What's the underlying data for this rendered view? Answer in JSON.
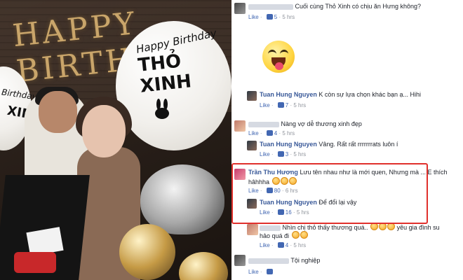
{
  "photo": {
    "banner_text": "HAPPY BIRTHDAY",
    "balloon_main_line1": "Happy Birthday",
    "balloon_main_line2": "THỎ XINH",
    "balloon_left_line1": "Birthday",
    "balloon_left_line2": "XINH"
  },
  "comments": [
    {
      "id": "c1",
      "text": "Cuối cùng Thỏ Xinh có chịu ăn Hưng không?",
      "like_label": "Like",
      "likes": "5",
      "time": "5 hrs"
    },
    {
      "id": "c2",
      "author": "Tuan Hung Nguyen",
      "text": "K còn sự lựa chọn khác bạn ạ... Hihi",
      "like_label": "Like",
      "likes": "7",
      "time": "5 hrs"
    },
    {
      "id": "c3",
      "text": "Nàng vợ dễ thương xinh đẹp",
      "like_label": "Like",
      "likes": "4",
      "time": "5 hrs"
    },
    {
      "id": "c4",
      "author": "Tuan Hung Nguyen",
      "text": "Vâng. Rất rất rrrrrrrats luôn í",
      "like_label": "Like",
      "likes": "3",
      "time": "5 hrs"
    },
    {
      "id": "c5",
      "author": "Trần Thu Hương",
      "text": "Lưu tên nhau như là mới quen, Nhưng mà ... E thích",
      "text2": "hâhhha",
      "like_label": "Like",
      "likes": "80",
      "time": "6 hrs"
    },
    {
      "id": "c6",
      "author": "Tuan Hung Nguyen",
      "text": "Để đổi lại vậy",
      "like_label": "Like",
      "likes": "16",
      "time": "5 hrs"
    },
    {
      "id": "c7",
      "text": "Nhìn chị thỏ thấy thương quá..",
      "text_after": "yêu gia đình su",
      "text2": "hảo quá đi",
      "like_label": "Like",
      "likes": "4",
      "time": "5 hrs"
    },
    {
      "id": "c8",
      "text": "Tội nghiệp",
      "like_label": "Like",
      "likes": "",
      "time": ""
    }
  ],
  "colors": {
    "author": "#385898",
    "meta": "#90949c",
    "highlight": "#e0302c"
  }
}
